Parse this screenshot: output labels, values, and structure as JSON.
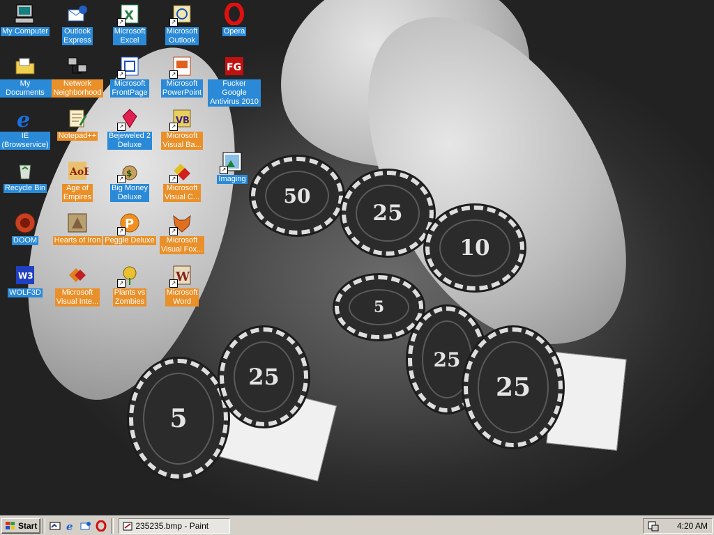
{
  "desktop": {
    "icons": [
      {
        "id": "my-computer",
        "label": "My Computer",
        "style": "blue",
        "shortcut": false,
        "icon": "computer-icon"
      },
      {
        "id": "my-documents",
        "label": "My Documents",
        "style": "blue",
        "shortcut": false,
        "icon": "folder-icon"
      },
      {
        "id": "ie",
        "label": "IE\n(Browservice)",
        "style": "blue",
        "shortcut": false,
        "icon": "internet-explorer-icon"
      },
      {
        "id": "recycle-bin",
        "label": "Recycle Bin",
        "style": "blue",
        "shortcut": false,
        "icon": "recycle-bin-icon"
      },
      {
        "id": "doom",
        "label": "DOOM",
        "style": "blue",
        "shortcut": false,
        "icon": "doom-icon"
      },
      {
        "id": "wolf3d",
        "label": "WOLF3D",
        "style": "blue",
        "shortcut": false,
        "icon": "wolf3d-icon"
      },
      {
        "id": "outlook-express",
        "label": "Outlook\nExpress",
        "style": "blue",
        "shortcut": false,
        "icon": "outlook-express-icon"
      },
      {
        "id": "network-neighborhood",
        "label": "Network\nNeighborhood",
        "style": "orange",
        "shortcut": false,
        "icon": "network-icon"
      },
      {
        "id": "notepadpp",
        "label": "Notepad++",
        "style": "orange",
        "shortcut": false,
        "icon": "notepad-icon"
      },
      {
        "id": "age-of-empires",
        "label": "Age of\nEmpires",
        "style": "orange",
        "shortcut": false,
        "icon": "age-of-empires-icon"
      },
      {
        "id": "hearts-of-iron",
        "label": "Hearts of Iron",
        "style": "orange",
        "shortcut": false,
        "icon": "hearts-of-iron-icon"
      },
      {
        "id": "ms-visual-interdev",
        "label": "Microsoft\nVisual Inte...",
        "style": "orange",
        "shortcut": false,
        "icon": "visual-interdev-icon"
      },
      {
        "id": "excel",
        "label": "Microsoft\nExcel",
        "style": "blue",
        "shortcut": true,
        "icon": "excel-icon"
      },
      {
        "id": "frontpage",
        "label": "Microsoft\nFrontPage",
        "style": "blue",
        "shortcut": true,
        "icon": "frontpage-icon"
      },
      {
        "id": "bejeweled",
        "label": "Bejeweled 2\nDeluxe",
        "style": "blue",
        "shortcut": true,
        "icon": "bejeweled-icon"
      },
      {
        "id": "big-money",
        "label": "Big Money\nDeluxe",
        "style": "blue",
        "shortcut": true,
        "icon": "money-bag-icon"
      },
      {
        "id": "peggle",
        "label": "Peggle Deluxe",
        "style": "orange",
        "shortcut": true,
        "icon": "peggle-icon"
      },
      {
        "id": "pvz",
        "label": "Plants vs\nZombies",
        "style": "orange",
        "shortcut": true,
        "icon": "plants-vs-zombies-icon"
      },
      {
        "id": "outlook",
        "label": "Microsoft\nOutlook",
        "style": "blue",
        "shortcut": true,
        "icon": "outlook-icon"
      },
      {
        "id": "powerpoint",
        "label": "Microsoft\nPowerPoint",
        "style": "blue",
        "shortcut": true,
        "icon": "powerpoint-icon"
      },
      {
        "id": "visual-basic",
        "label": "Microsoft\nVisual Ba...",
        "style": "orange",
        "shortcut": true,
        "icon": "visual-basic-icon"
      },
      {
        "id": "visual-c",
        "label": "Microsoft\nVisual C...",
        "style": "orange",
        "shortcut": true,
        "icon": "visual-c-icon"
      },
      {
        "id": "visual-foxpro",
        "label": "Microsoft\nVisual Fox...",
        "style": "orange",
        "shortcut": true,
        "icon": "visual-foxpro-icon"
      },
      {
        "id": "word",
        "label": "Microsoft\nWord",
        "style": "orange",
        "shortcut": true,
        "icon": "word-icon"
      },
      {
        "id": "opera",
        "label": "Opera",
        "style": "blue",
        "shortcut": false,
        "icon": "opera-icon"
      },
      {
        "id": "fucker-google",
        "label": "Fucker Google\nAntivirus 2010",
        "style": "blue",
        "shortcut": false,
        "icon": "antivirus-icon"
      },
      {
        "id": "imaging",
        "label": "Imaging",
        "style": "blue",
        "shortcut": true,
        "icon": "imaging-icon"
      }
    ],
    "background_chips": [
      "50",
      "25",
      "10",
      "5",
      "25",
      "5",
      "25",
      "25"
    ]
  },
  "taskbar": {
    "start_label": "Start",
    "quick_launch": [
      "show-desktop-icon",
      "internet-explorer-icon",
      "outlook-express-icon",
      "opera-icon"
    ],
    "task_label": "235235.bmp - Paint",
    "clock": "4:20 AM"
  },
  "colors": {
    "label_blue": "#2a8ad8",
    "label_orange": "#e9902a",
    "taskbar": "#d4d0c8"
  }
}
